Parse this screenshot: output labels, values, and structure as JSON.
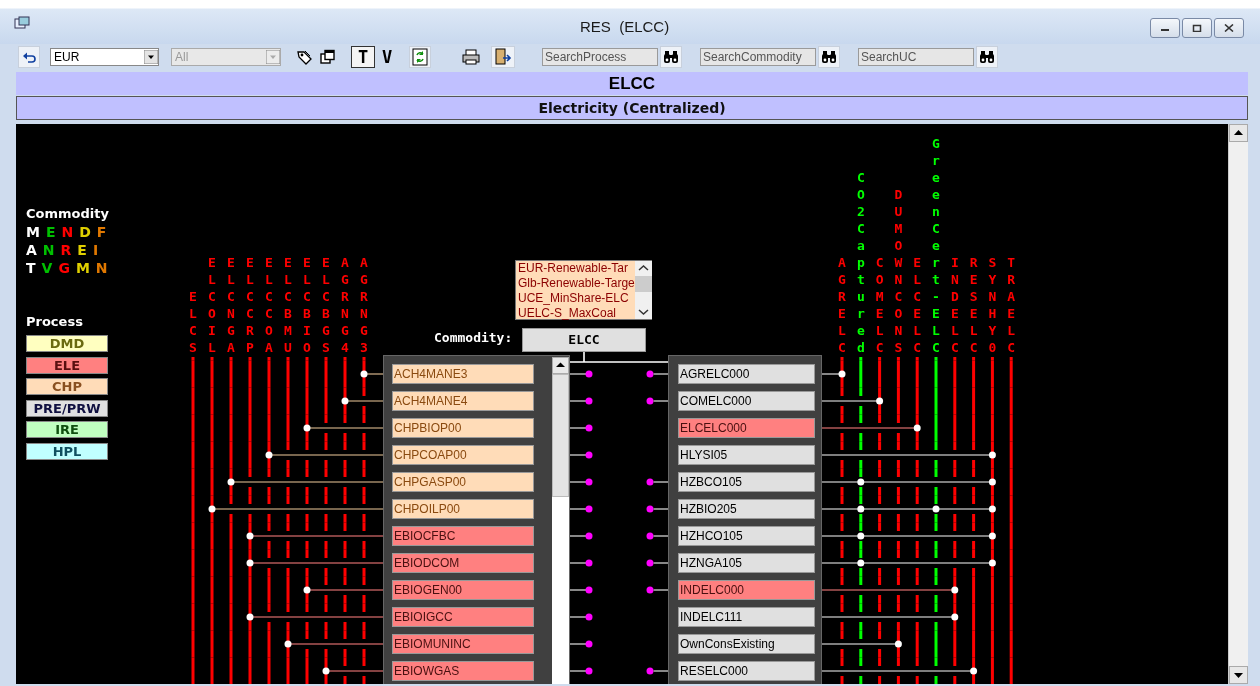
{
  "window": {
    "title": "RES  (ELCC)"
  },
  "toolbar": {
    "region": {
      "value": "EUR",
      "disabled": false
    },
    "filter": {
      "value": "All",
      "disabled": true
    },
    "view_buttons": [
      {
        "label": "T",
        "selected": true
      },
      {
        "label": "V",
        "selected": false
      }
    ],
    "search_fields": [
      {
        "placeholder": "SearchProcess"
      },
      {
        "placeholder": "SearchCommodity"
      },
      {
        "placeholder": "SearchUC"
      }
    ]
  },
  "header": {
    "title": "ELCC",
    "subtitle": "Electricity (Centralized)"
  },
  "legend": {
    "commodity_title": "Commodity",
    "commodity_rows": [
      {
        "letters": [
          {
            "letter": "M",
            "color": "#ffffff"
          },
          {
            "letter": "E",
            "color": "#00c000"
          },
          {
            "letter": "N",
            "color": "#ff0000"
          },
          {
            "letter": "D",
            "color": "#e0d000"
          },
          {
            "letter": "F",
            "color": "#e07800"
          }
        ]
      },
      {
        "letters": [
          {
            "letter": "A",
            "color": "#ffffff"
          },
          {
            "letter": "N",
            "color": "#00c000"
          },
          {
            "letter": "R",
            "color": "#ff0000"
          },
          {
            "letter": "E",
            "color": "#e0d000"
          },
          {
            "letter": "I",
            "color": "#e07800"
          }
        ]
      },
      {
        "letters": [
          {
            "letter": "T",
            "color": "#ffffff"
          },
          {
            "letter": "V",
            "color": "#00c000"
          },
          {
            "letter": "G",
            "color": "#ff0000"
          },
          {
            "letter": "M",
            "color": "#e0d000"
          },
          {
            "letter": "N",
            "color": "#e07800"
          }
        ]
      }
    ],
    "process_title": "Process",
    "process_types": [
      {
        "label": "DMD",
        "color": "#ffffc0"
      },
      {
        "label": "ELE",
        "color": "#ff8080"
      },
      {
        "label": "CHP",
        "color": "#ffdcb8"
      },
      {
        "label": "PRE/PRW",
        "color": "#e0e0e0"
      },
      {
        "label": "IRE",
        "color": "#c0ffc0"
      },
      {
        "label": "HPL",
        "color": "#c0ffff"
      }
    ]
  },
  "constraints": {
    "items": [
      "EUR-Renewable-Tar",
      "Glb-Renewable-Targe",
      "UCE_MinShare-ELC",
      "UELC-S_MaxCoal"
    ]
  },
  "commodity": {
    "label": "Commodity:",
    "value": "ELCC"
  },
  "inputs": [
    {
      "name": "ELCS",
      "color": "#ff0000"
    },
    {
      "name": "ELCOIL",
      "color": "#ff0000"
    },
    {
      "name": "ELCNGA",
      "color": "#ff0000"
    },
    {
      "name": "ELCCRP",
      "color": "#ff0000"
    },
    {
      "name": "ELCCOA",
      "color": "#ff0000"
    },
    {
      "name": "ELCBMU",
      "color": "#ff0000"
    },
    {
      "name": "ELCBIO",
      "color": "#ff0000"
    },
    {
      "name": "ELCBGS",
      "color": "#ff0000"
    },
    {
      "name": "AGRNG4",
      "color": "#ff0000"
    },
    {
      "name": "AGRNG3",
      "color": "#ff0000"
    }
  ],
  "outputs": [
    {
      "name": "AGRELC",
      "color": "#ff0000"
    },
    {
      "name": "CO2Captured",
      "color": "#00ff00"
    },
    {
      "name": "COMELC",
      "color": "#ff0000"
    },
    {
      "name": "DUMOWNCONS",
      "color": "#ff0000"
    },
    {
      "name": "ELCELC",
      "color": "#ff0000"
    },
    {
      "name": "GreenCert-ELC",
      "color": "#00ff00"
    },
    {
      "name": "INDELC",
      "color": "#ff0000"
    },
    {
      "name": "RESELC",
      "color": "#ff0000"
    },
    {
      "name": "SYNHY0",
      "color": "#ff0000"
    },
    {
      "name": "TRAELC",
      "color": "#ff0000"
    }
  ],
  "input_processes": [
    {
      "name": "ACH4MANE3",
      "kind": "chp",
      "linked": true,
      "connections": [
        false,
        false,
        false,
        false,
        false,
        false,
        false,
        false,
        false,
        true
      ]
    },
    {
      "name": "ACH4MANE4",
      "kind": "chp",
      "linked": true,
      "connections": [
        false,
        false,
        false,
        false,
        false,
        false,
        false,
        false,
        true,
        false
      ]
    },
    {
      "name": "CHPBIOP00",
      "kind": "chp",
      "linked": true,
      "connections": [
        false,
        false,
        false,
        false,
        false,
        false,
        true,
        false,
        false,
        false
      ]
    },
    {
      "name": "CHPCOAP00",
      "kind": "chp",
      "linked": true,
      "connections": [
        false,
        false,
        false,
        false,
        true,
        false,
        false,
        false,
        false,
        false
      ]
    },
    {
      "name": "CHPGASP00",
      "kind": "chp",
      "linked": true,
      "connections": [
        false,
        false,
        true,
        false,
        false,
        false,
        false,
        false,
        false,
        false
      ]
    },
    {
      "name": "CHPOILP00",
      "kind": "chp",
      "linked": true,
      "connections": [
        false,
        true,
        false,
        false,
        false,
        false,
        false,
        false,
        false,
        false
      ]
    },
    {
      "name": "EBIOCFBC",
      "kind": "ele",
      "linked": true,
      "connections": [
        false,
        false,
        false,
        true,
        false,
        false,
        false,
        false,
        false,
        false
      ]
    },
    {
      "name": "EBIODCOM",
      "kind": "ele",
      "linked": true,
      "connections": [
        false,
        false,
        false,
        true,
        false,
        false,
        false,
        false,
        false,
        false
      ]
    },
    {
      "name": "EBIOGEN00",
      "kind": "ele",
      "linked": true,
      "connections": [
        false,
        false,
        false,
        false,
        false,
        false,
        true,
        false,
        false,
        false
      ]
    },
    {
      "name": "EBIOIGCC",
      "kind": "ele",
      "linked": true,
      "connections": [
        false,
        false,
        false,
        true,
        false,
        false,
        false,
        false,
        false,
        false
      ]
    },
    {
      "name": "EBIOMUNINC",
      "kind": "ele",
      "linked": true,
      "connections": [
        false,
        false,
        false,
        false,
        false,
        true,
        false,
        false,
        false,
        false
      ]
    },
    {
      "name": "EBIOWGAS",
      "kind": "ele",
      "linked": true,
      "connections": [
        false,
        false,
        false,
        false,
        false,
        false,
        false,
        true,
        false,
        false
      ]
    }
  ],
  "output_processes": [
    {
      "name": "AGRELC000",
      "kind": "pre",
      "linked": true,
      "connections": [
        true,
        false,
        false,
        false,
        false,
        false,
        false,
        false,
        false,
        false
      ]
    },
    {
      "name": "COMELC000",
      "kind": "pre",
      "linked": true,
      "connections": [
        false,
        false,
        true,
        false,
        false,
        false,
        false,
        false,
        false,
        false
      ]
    },
    {
      "name": "ELCELC000",
      "kind": "ele",
      "linked": false,
      "connections": [
        false,
        false,
        false,
        false,
        true,
        false,
        false,
        false,
        false,
        false
      ]
    },
    {
      "name": "HLYSI05",
      "kind": "pre",
      "linked": false,
      "connections": [
        false,
        false,
        false,
        false,
        false,
        false,
        false,
        false,
        true,
        false
      ]
    },
    {
      "name": "HZBCO105",
      "kind": "pre",
      "linked": true,
      "connections": [
        false,
        true,
        false,
        false,
        false,
        false,
        false,
        false,
        true,
        false
      ]
    },
    {
      "name": "HZBIO205",
      "kind": "pre",
      "linked": true,
      "connections": [
        false,
        true,
        false,
        false,
        false,
        true,
        false,
        false,
        true,
        false
      ]
    },
    {
      "name": "HZHCO105",
      "kind": "pre",
      "linked": true,
      "connections": [
        false,
        true,
        false,
        false,
        false,
        false,
        false,
        false,
        true,
        false
      ]
    },
    {
      "name": "HZNGA105",
      "kind": "pre",
      "linked": true,
      "connections": [
        false,
        true,
        false,
        false,
        false,
        false,
        false,
        false,
        true,
        false
      ]
    },
    {
      "name": "INDELC000",
      "kind": "ele",
      "linked": true,
      "connections": [
        false,
        false,
        false,
        false,
        false,
        false,
        true,
        false,
        false,
        false
      ]
    },
    {
      "name": "INDELC111",
      "kind": "pre",
      "linked": false,
      "connections": [
        false,
        false,
        false,
        false,
        false,
        false,
        true,
        false,
        false,
        false
      ]
    },
    {
      "name": "OwnConsExisting",
      "kind": "pre",
      "linked": false,
      "connections": [
        false,
        false,
        false,
        true,
        false,
        false,
        false,
        false,
        false,
        false
      ]
    },
    {
      "name": "RESELC000",
      "kind": "pre",
      "linked": true,
      "connections": [
        false,
        false,
        false,
        false,
        false,
        false,
        false,
        true,
        false,
        false
      ]
    }
  ]
}
